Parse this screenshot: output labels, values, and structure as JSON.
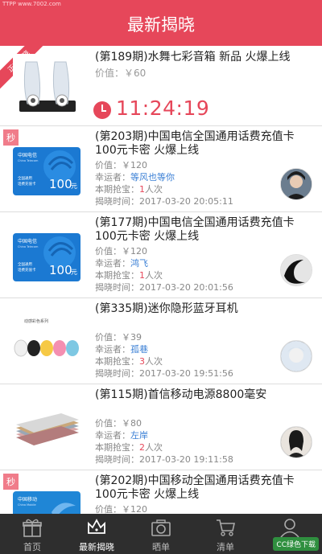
{
  "header": {
    "watermark": "TTPP www.7002.com",
    "title": "最新揭晓"
  },
  "labels": {
    "price": "价值：",
    "winner": "幸运者：",
    "count": "本期抢宝：",
    "count_unit": "人次",
    "time": "揭晓时间："
  },
  "featured": {
    "ribbon": "正在揭晓",
    "title": "(第189期)水舞七彩音箱 新品 火爆上线",
    "price": "价值：￥60",
    "countdown": "11:24:19"
  },
  "items": [
    {
      "badge": "秒",
      "title": "(第203期)中国电信全国通用话费充值卡100元卡密 火爆上线",
      "price": "￥120",
      "winner": "等风也等你",
      "count": "1",
      "time": "2017-03-20 20:05:11",
      "card_brand": "中国电信",
      "card_en": "China Telecom",
      "card_sub1": "全国通用",
      "card_sub2": "话费充值卡",
      "card_value": "100",
      "card_unit": "元"
    },
    {
      "badge": "",
      "title": "(第177期)中国电信全国通用话费充值卡100元卡密 火爆上线",
      "price": "￥120",
      "winner": "鸿飞",
      "count": "1",
      "time": "2017-03-20 20:01:56",
      "card_brand": "中国电信",
      "card_en": "China Telecom",
      "card_sub1": "全国通用",
      "card_sub2": "话费充值卡",
      "card_value": "100",
      "card_unit": "元"
    },
    {
      "badge": "",
      "title": "(第335期)迷你隐形蓝牙耳机",
      "price": "￥39",
      "winner": "孤巷",
      "count": "3",
      "time": "2017-03-20 19:51:56",
      "thumb_caption": "动感彩色系列"
    },
    {
      "badge": "",
      "title": "(第115期)首信移动电源8800毫安",
      "price": "￥80",
      "winner": "左岸",
      "count": "2",
      "time": "2017-03-20 19:11:58"
    },
    {
      "badge": "秒",
      "title": "(第202期)中国移动全国通用话费充值卡100元卡密 火爆上线",
      "price": "￥120",
      "card_brand": "中国移动",
      "card_en": "China Mobile"
    }
  ],
  "tabs": [
    {
      "label": "首页",
      "icon": "gift-icon"
    },
    {
      "label": "最新揭晓",
      "icon": "crown-icon"
    },
    {
      "label": "晒单",
      "icon": "camera-icon"
    },
    {
      "label": "清单",
      "icon": "cart-icon"
    },
    {
      "label": "",
      "icon": "user-icon"
    }
  ],
  "corner_logo": "CC绿色下载",
  "colors": {
    "accent": "#e6475a",
    "link": "#3a7fd5",
    "tabbar": "#2e2e2e"
  }
}
